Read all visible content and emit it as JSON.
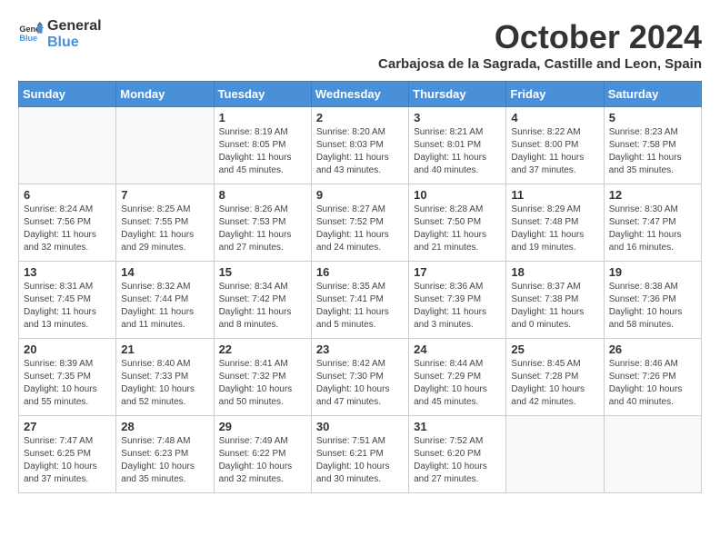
{
  "header": {
    "logo_line1": "General",
    "logo_line2": "Blue",
    "month_title": "October 2024",
    "location": "Carbajosa de la Sagrada, Castille and Leon, Spain"
  },
  "days_of_week": [
    "Sunday",
    "Monday",
    "Tuesday",
    "Wednesday",
    "Thursday",
    "Friday",
    "Saturday"
  ],
  "weeks": [
    [
      {
        "day": "",
        "info": ""
      },
      {
        "day": "",
        "info": ""
      },
      {
        "day": "1",
        "info": "Sunrise: 8:19 AM\nSunset: 8:05 PM\nDaylight: 11 hours and 45 minutes."
      },
      {
        "day": "2",
        "info": "Sunrise: 8:20 AM\nSunset: 8:03 PM\nDaylight: 11 hours and 43 minutes."
      },
      {
        "day": "3",
        "info": "Sunrise: 8:21 AM\nSunset: 8:01 PM\nDaylight: 11 hours and 40 minutes."
      },
      {
        "day": "4",
        "info": "Sunrise: 8:22 AM\nSunset: 8:00 PM\nDaylight: 11 hours and 37 minutes."
      },
      {
        "day": "5",
        "info": "Sunrise: 8:23 AM\nSunset: 7:58 PM\nDaylight: 11 hours and 35 minutes."
      }
    ],
    [
      {
        "day": "6",
        "info": "Sunrise: 8:24 AM\nSunset: 7:56 PM\nDaylight: 11 hours and 32 minutes."
      },
      {
        "day": "7",
        "info": "Sunrise: 8:25 AM\nSunset: 7:55 PM\nDaylight: 11 hours and 29 minutes."
      },
      {
        "day": "8",
        "info": "Sunrise: 8:26 AM\nSunset: 7:53 PM\nDaylight: 11 hours and 27 minutes."
      },
      {
        "day": "9",
        "info": "Sunrise: 8:27 AM\nSunset: 7:52 PM\nDaylight: 11 hours and 24 minutes."
      },
      {
        "day": "10",
        "info": "Sunrise: 8:28 AM\nSunset: 7:50 PM\nDaylight: 11 hours and 21 minutes."
      },
      {
        "day": "11",
        "info": "Sunrise: 8:29 AM\nSunset: 7:48 PM\nDaylight: 11 hours and 19 minutes."
      },
      {
        "day": "12",
        "info": "Sunrise: 8:30 AM\nSunset: 7:47 PM\nDaylight: 11 hours and 16 minutes."
      }
    ],
    [
      {
        "day": "13",
        "info": "Sunrise: 8:31 AM\nSunset: 7:45 PM\nDaylight: 11 hours and 13 minutes."
      },
      {
        "day": "14",
        "info": "Sunrise: 8:32 AM\nSunset: 7:44 PM\nDaylight: 11 hours and 11 minutes."
      },
      {
        "day": "15",
        "info": "Sunrise: 8:34 AM\nSunset: 7:42 PM\nDaylight: 11 hours and 8 minutes."
      },
      {
        "day": "16",
        "info": "Sunrise: 8:35 AM\nSunset: 7:41 PM\nDaylight: 11 hours and 5 minutes."
      },
      {
        "day": "17",
        "info": "Sunrise: 8:36 AM\nSunset: 7:39 PM\nDaylight: 11 hours and 3 minutes."
      },
      {
        "day": "18",
        "info": "Sunrise: 8:37 AM\nSunset: 7:38 PM\nDaylight: 11 hours and 0 minutes."
      },
      {
        "day": "19",
        "info": "Sunrise: 8:38 AM\nSunset: 7:36 PM\nDaylight: 10 hours and 58 minutes."
      }
    ],
    [
      {
        "day": "20",
        "info": "Sunrise: 8:39 AM\nSunset: 7:35 PM\nDaylight: 10 hours and 55 minutes."
      },
      {
        "day": "21",
        "info": "Sunrise: 8:40 AM\nSunset: 7:33 PM\nDaylight: 10 hours and 52 minutes."
      },
      {
        "day": "22",
        "info": "Sunrise: 8:41 AM\nSunset: 7:32 PM\nDaylight: 10 hours and 50 minutes."
      },
      {
        "day": "23",
        "info": "Sunrise: 8:42 AM\nSunset: 7:30 PM\nDaylight: 10 hours and 47 minutes."
      },
      {
        "day": "24",
        "info": "Sunrise: 8:44 AM\nSunset: 7:29 PM\nDaylight: 10 hours and 45 minutes."
      },
      {
        "day": "25",
        "info": "Sunrise: 8:45 AM\nSunset: 7:28 PM\nDaylight: 10 hours and 42 minutes."
      },
      {
        "day": "26",
        "info": "Sunrise: 8:46 AM\nSunset: 7:26 PM\nDaylight: 10 hours and 40 minutes."
      }
    ],
    [
      {
        "day": "27",
        "info": "Sunrise: 7:47 AM\nSunset: 6:25 PM\nDaylight: 10 hours and 37 minutes."
      },
      {
        "day": "28",
        "info": "Sunrise: 7:48 AM\nSunset: 6:23 PM\nDaylight: 10 hours and 35 minutes."
      },
      {
        "day": "29",
        "info": "Sunrise: 7:49 AM\nSunset: 6:22 PM\nDaylight: 10 hours and 32 minutes."
      },
      {
        "day": "30",
        "info": "Sunrise: 7:51 AM\nSunset: 6:21 PM\nDaylight: 10 hours and 30 minutes."
      },
      {
        "day": "31",
        "info": "Sunrise: 7:52 AM\nSunset: 6:20 PM\nDaylight: 10 hours and 27 minutes."
      },
      {
        "day": "",
        "info": ""
      },
      {
        "day": "",
        "info": ""
      }
    ]
  ]
}
